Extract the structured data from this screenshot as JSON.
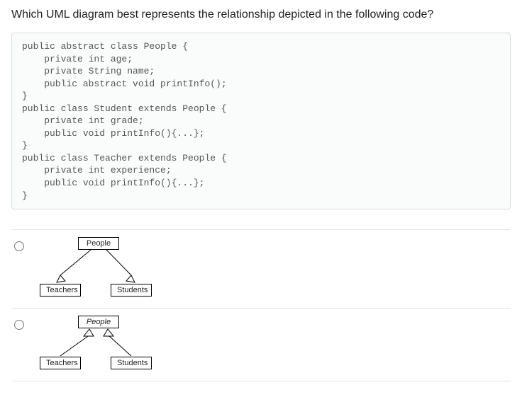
{
  "question": "Which UML diagram best represents the relationship depicted in the following code?",
  "code": "public abstract class People {\n    private int age;\n    private String name;\n    public abstract void printInfo();\n}\npublic class Student extends People {\n    private int grade;\n    public void printInfo(){...};\n}\npublic class Teacher extends People {\n    private int experience;\n    public void printInfo(){...};\n}",
  "options": [
    {
      "top": "People",
      "left": "Teachers",
      "right": "Students",
      "top_italic": false
    },
    {
      "top": "People",
      "left": "Teachers",
      "right": "Students",
      "top_italic": true
    }
  ]
}
